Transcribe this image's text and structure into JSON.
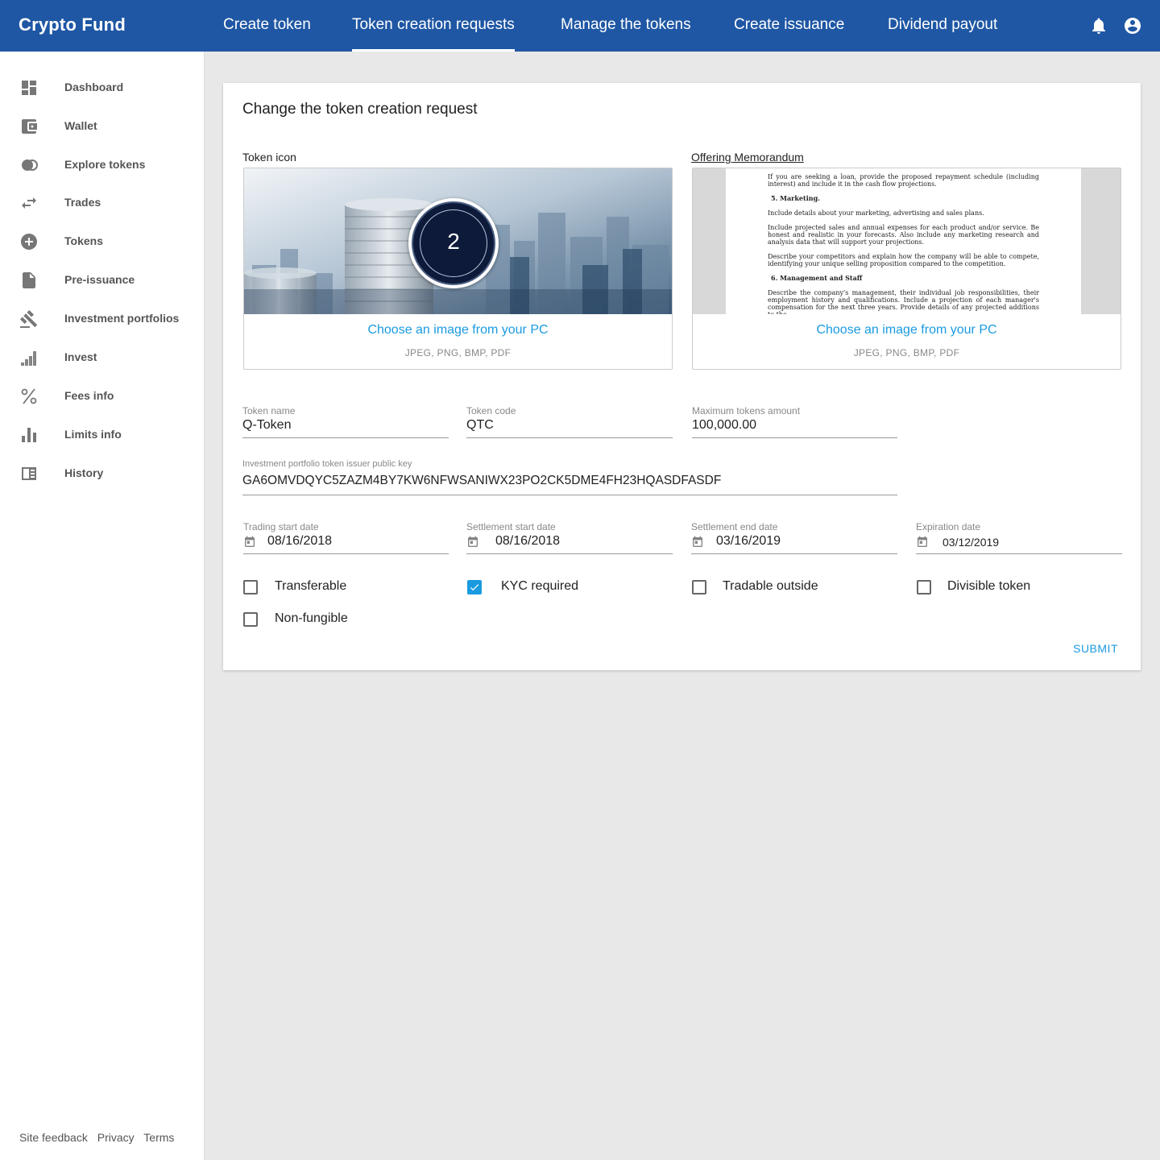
{
  "app": {
    "brand": "Crypto Fund"
  },
  "nav": {
    "tabs": [
      {
        "label": "Create token"
      },
      {
        "label": "Token creation requests"
      },
      {
        "label": "Manage the tokens"
      },
      {
        "label": "Create issuance"
      },
      {
        "label": "Dividend payout"
      }
    ],
    "active_tab": "Token creation requests"
  },
  "sidebar": {
    "items": [
      {
        "label": "Dashboard",
        "icon": "dashboard-icon"
      },
      {
        "label": "Wallet",
        "icon": "wallet-icon"
      },
      {
        "label": "Explore tokens",
        "icon": "explore-tokens-icon"
      },
      {
        "label": "Trades",
        "icon": "swap-icon"
      },
      {
        "label": "Tokens",
        "icon": "add-circle-icon"
      },
      {
        "label": "Pre-issuance",
        "icon": "document-icon"
      },
      {
        "label": "Investment portfolios",
        "icon": "gavel-icon"
      },
      {
        "label": "Invest",
        "icon": "signal-bars-icon"
      },
      {
        "label": "Fees info",
        "icon": "percent-icon"
      },
      {
        "label": "Limits info",
        "icon": "bar-chart-icon"
      },
      {
        "label": "History",
        "icon": "history-icon"
      }
    ],
    "footer": {
      "feedback": "Site feedback",
      "privacy": "Privacy",
      "terms": "Terms"
    }
  },
  "form": {
    "title": "Change the token creation request",
    "token_icon": {
      "label": "Token icon",
      "badge_number": "2",
      "choose_text": "Choose an image from your PC",
      "formats": "JPEG, PNG, BMP, PDF"
    },
    "memorandum": {
      "label": "Offering Memorandum",
      "choose_text": "Choose an image from your PC",
      "formats": "JPEG, PNG, BMP, PDF",
      "doc": {
        "p1": "If you are seeking a loan, provide the proposed repayment schedule (including interest) and include it in the cash flow projections.",
        "h5": "5.  Marketing.",
        "p2": "Include details about your marketing, advertising and sales plans.",
        "p3": "Include projected sales and annual expenses for each product and/or service. Be honest and realistic in your forecasts. Also include any marketing research and analysis data that will support your projections.",
        "p4": "Describe your competitors and explain how the company will be able to compete, identifying your unique selling proposition compared to the competition.",
        "h6": "6.  Management and Staff",
        "p5": "Describe the company's management, their individual job responsibilities, their employment history and qualifications. Include a projection of each manager's compensation for the next three years. Provide details of any projected additions to the"
      }
    },
    "fields": {
      "token_name": {
        "label": "Token name",
        "value": "Q-Token"
      },
      "token_code": {
        "label": "Token code",
        "value": "QTC"
      },
      "max_amount": {
        "label": "Maximum tokens amount",
        "value": "100,000.00"
      },
      "public_key": {
        "label": "Investment portfolio token issuer public key",
        "value": "GA6OMVDQYC5ZAZM4BY7KW6NFWSANIWX23PO2CK5DME4FH23HQASDFASDF"
      },
      "trading_start": {
        "label": "Trading start date",
        "value": "08/16/2018"
      },
      "settlement_start": {
        "label": "Settlement start date",
        "value": "08/16/2018"
      },
      "settlement_end": {
        "label": "Settlement end date",
        "value": "03/16/2019"
      },
      "expiration": {
        "label": "Expiration date",
        "value": "03/12/2019"
      }
    },
    "checkboxes": [
      {
        "label": "Transferable",
        "checked": false
      },
      {
        "label": "KYC required",
        "checked": true
      },
      {
        "label": "Tradable outside",
        "checked": false
      },
      {
        "label": "Divisible token",
        "checked": false
      },
      {
        "label": "Non-fungible",
        "checked": false
      }
    ],
    "submit_label": "SUBMIT"
  },
  "colors": {
    "primary": "#1f57a4",
    "accent": "#1a9be0",
    "background": "#e8e8e8"
  }
}
